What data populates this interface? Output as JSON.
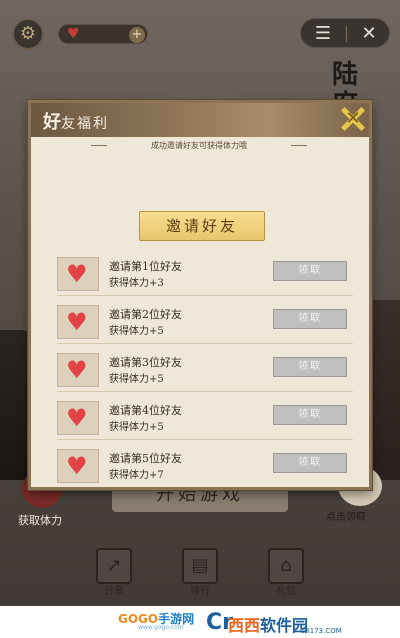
{
  "background": {
    "scene_title": "陆府",
    "start_button_label": "开始游戏",
    "left_label": "获取体力",
    "right_label": "点击领取",
    "bottom_icons": [
      {
        "icon": "share-icon",
        "caption": "分享"
      },
      {
        "icon": "rank-icon",
        "caption": "排行"
      },
      {
        "icon": "gift-icon",
        "caption": "礼包"
      }
    ]
  },
  "top_bar": {
    "menu_icon": "menu-icon",
    "close_icon": "close-icon"
  },
  "modal": {
    "title_big": "好",
    "title_small": "友福利",
    "banner": "成功邀请好友可获得体力哦",
    "invite_button": "邀请好友",
    "rows": [
      {
        "line1": "邀请第1位好友",
        "line2": "获得体力+3",
        "button": "领取"
      },
      {
        "line1": "邀请第2位好友",
        "line2": "获得体力+5",
        "button": "领取"
      },
      {
        "line1": "邀请第3位好友",
        "line2": "获得体力+5",
        "button": "领取"
      },
      {
        "line1": "邀请第4位好友",
        "line2": "获得体力+5",
        "button": "领取"
      },
      {
        "line1": "邀请第5位好友",
        "line2": "获得体力+7",
        "button": "领取"
      }
    ]
  },
  "watermark": {
    "left_brand_a": "GOGO",
    "left_brand_b": "手游网",
    "left_url": "www.gogo.com",
    "right_logo": "Cr",
    "right_brand_a": "西西",
    "right_brand_b": "软件园",
    "right_url": "CR173.COM"
  },
  "colors": {
    "modal_bg": "#efe7d7",
    "header_brown": "#8d7456",
    "invite_gold": "#e9c56a",
    "heart_red": "#e04444",
    "claim_gray": "#bfbfbf"
  }
}
